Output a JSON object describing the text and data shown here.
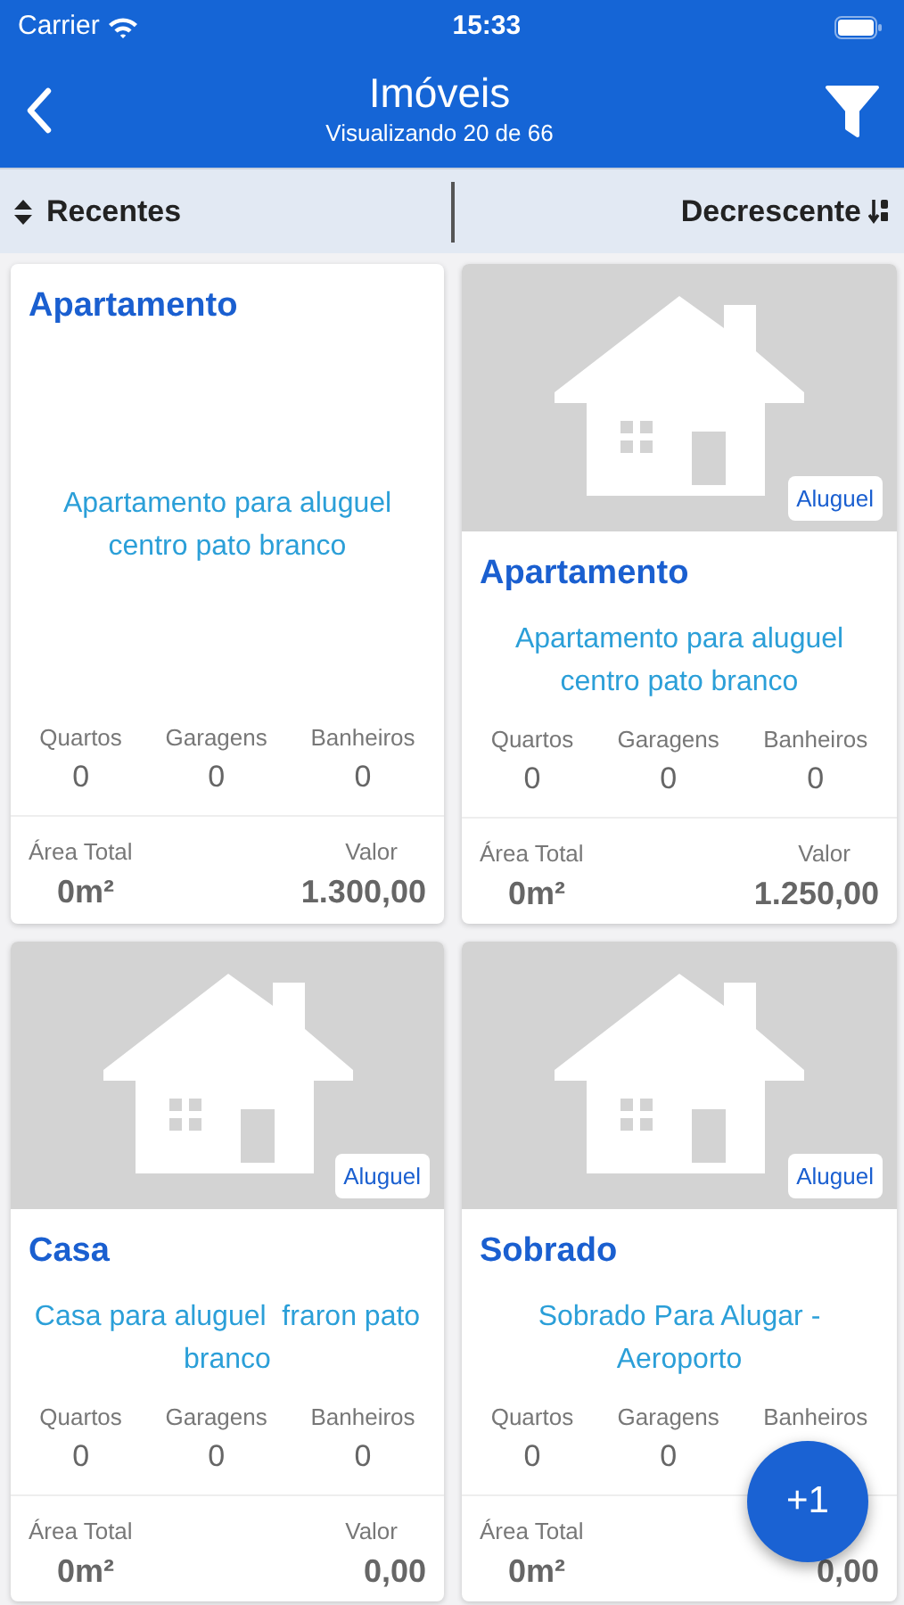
{
  "status_bar": {
    "carrier": "Carrier",
    "time": "15:33"
  },
  "header": {
    "title": "Imóveis",
    "subtitle": "Visualizando 20 de 66"
  },
  "sort_bar": {
    "sort_by": "Recentes",
    "order": "Decrescente"
  },
  "cards": [
    {
      "kind": "plain",
      "title": "Apartamento",
      "description": "Apartamento para aluguel centro pato branco",
      "stats": [
        {
          "label": "Quartos",
          "value": "0"
        },
        {
          "label": "Garagens",
          "value": "0"
        },
        {
          "label": "Banheiros",
          "value": "0"
        }
      ],
      "area_label": "Área Total",
      "area": "0m²",
      "price_label": "Valor",
      "price": "1.300,00"
    },
    {
      "kind": "photo",
      "tag": "Aluguel",
      "title": "Apartamento",
      "description": "Apartamento para aluguel centro pato branco",
      "stats": [
        {
          "label": "Quartos",
          "value": "0"
        },
        {
          "label": "Garagens",
          "value": "0"
        },
        {
          "label": "Banheiros",
          "value": "0"
        }
      ],
      "area_label": "Área Total",
      "area": "0m²",
      "price_label": "Valor",
      "price": "1.250,00"
    },
    {
      "kind": "photo",
      "tag": "Aluguel",
      "title": "Casa",
      "description": "Casa para aluguel  fraron pato branco",
      "stats": [
        {
          "label": "Quartos",
          "value": "0"
        },
        {
          "label": "Garagens",
          "value": "0"
        },
        {
          "label": "Banheiros",
          "value": "0"
        }
      ],
      "area_label": "Área Total",
      "area": "0m²",
      "price_label": "Valor",
      "price": "0,00"
    },
    {
      "kind": "photo",
      "tag": "Aluguel",
      "title": "Sobrado",
      "description": "Sobrado Para Alugar - Aeroporto",
      "stats": [
        {
          "label": "Quartos",
          "value": "0"
        },
        {
          "label": "Garagens",
          "value": "0"
        },
        {
          "label": "Banheiros"
        }
      ],
      "area_label": "Área Total",
      "area": "0m²",
      "price": "0,00"
    }
  ],
  "fab": {
    "label": "+1"
  }
}
